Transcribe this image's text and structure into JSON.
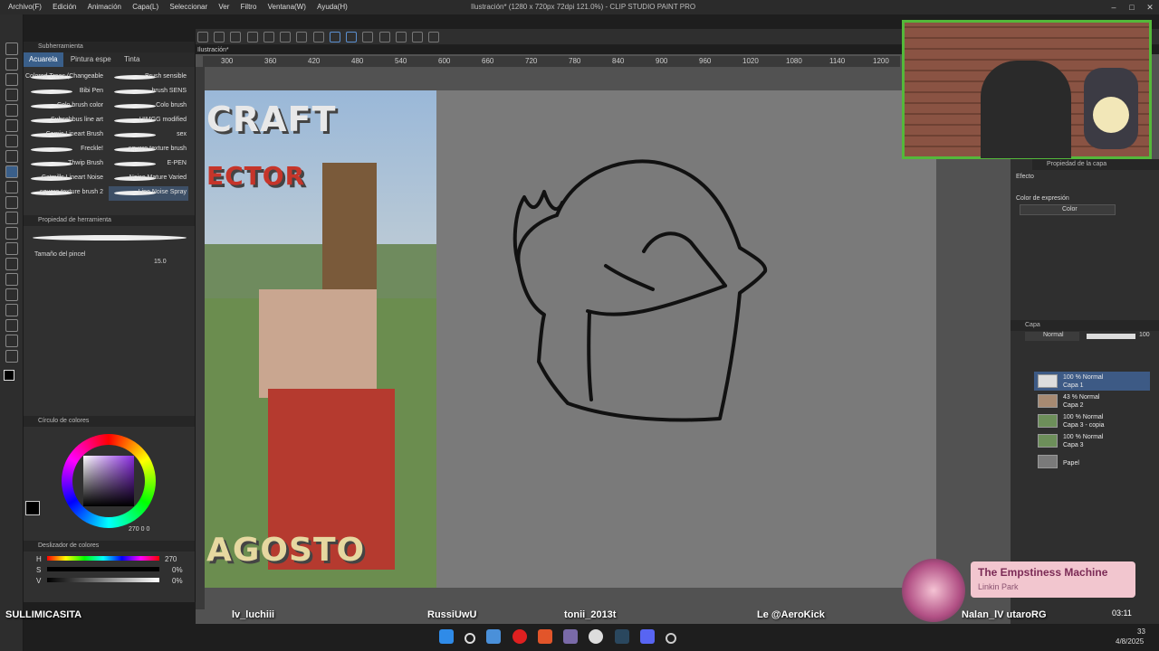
{
  "window": {
    "title": "Ilustración* (1280 x 720px 72dpi 121.0%) - CLIP STUDIO PAINT PRO",
    "doc_tab": "Ilustración*"
  },
  "menu": [
    "Archivo(F)",
    "Edición",
    "Animación",
    "Capa(L)",
    "Seleccionar",
    "Ver",
    "Filtro",
    "Ventana(W)",
    "Ayuda(H)"
  ],
  "subtool_panel": {
    "title": "Subherramienta",
    "tabs": [
      "Acuarela",
      "Pintura espe",
      "Tinta"
    ],
    "brushes_left": [
      "Colored Trees (Changeable",
      "Bibi Pen",
      "Colo brush color",
      "Subsebbus line art",
      "Comic Lineart Brush",
      "Freckle!",
      "Thwip Brush",
      "Catmills Lineart Noise",
      "square texture brush 2"
    ],
    "brushes_right": [
      "Brush sensible",
      "brush SENS",
      "Colo brush",
      "HIMGG modified",
      "sex",
      "square texture brush",
      "E-PEN",
      "Noise Mature Varied",
      "Line Noise Spray"
    ]
  },
  "tool_property": {
    "title": "Propiedad de herramienta",
    "brush_size_label": "Tamaño del pincel",
    "brush_size_value": "15.0"
  },
  "color_wheel": {
    "title": "Círculo de colores",
    "values": "270  0  0"
  },
  "color_slider": {
    "title": "Deslizador de colores",
    "h_label": "H",
    "h_value": "270",
    "s_label": "S",
    "s_value": "0%",
    "v_label": "V",
    "v_value": "0%"
  },
  "ruler_ticks": [
    "300",
    "360",
    "420",
    "480",
    "540",
    "600",
    "660",
    "720",
    "780",
    "840",
    "900",
    "960",
    "1020",
    "1080",
    "1140",
    "1200"
  ],
  "canvas_image": {
    "top_word": "CRAFT",
    "sub_word": "ECTOR",
    "bottom_word": "AGOSTO"
  },
  "layer_property": {
    "title": "Propiedad de la capa",
    "effect_label": "Efecto",
    "expression_label": "Color de expresión",
    "expression_value": "Color"
  },
  "layers_panel": {
    "title": "Capa",
    "blend_mode": "Normal",
    "opacity": "100",
    "layers": [
      {
        "line1": "100 % Normal",
        "line2": "Capa 1",
        "selected": true
      },
      {
        "line1": "43 % Normal",
        "line2": "Capa 2",
        "selected": false
      },
      {
        "line1": "100 % Normal",
        "line2": "Capa 3 - copia",
        "selected": false
      },
      {
        "line1": "100 % Normal",
        "line2": "Capa 3",
        "selected": false
      },
      {
        "line1": "",
        "line2": "Papel",
        "selected": false
      }
    ]
  },
  "chat_users": [
    "SULLIMICASITA",
    "lv_luchiii",
    "RussiUwU",
    "tonii_2013t",
    "Le @AeroKick",
    "Nalan_lV utaroRG"
  ],
  "music": {
    "title": "The Empstiness Machine",
    "artist": "Linkin Park",
    "time": "03:11"
  },
  "clock": {
    "time": "33",
    "date": "4/8/2025"
  },
  "colors": {
    "accent": "#3a5f8a",
    "webcam_border": "#54b83a",
    "music_bg": "#f2c6cf"
  }
}
